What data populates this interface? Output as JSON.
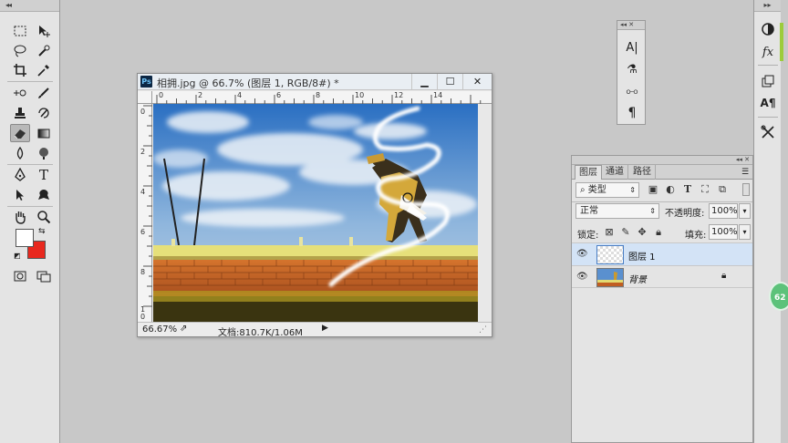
{
  "toolbox": {
    "grip": "◂◂",
    "tools": [
      {
        "name": "marquee-tool",
        "icon": "marquee-icon"
      },
      {
        "name": "move-tool",
        "icon": "move-icon"
      },
      {
        "name": "lasso-tool",
        "icon": "lasso-icon"
      },
      {
        "name": "quick-selection-tool",
        "icon": "quick-selection-icon"
      },
      {
        "name": "crop-tool",
        "icon": "crop-icon"
      },
      {
        "name": "eyedropper-tool",
        "icon": "eyedropper-icon"
      },
      {
        "name": "spot-healing-tool",
        "icon": "healing-icon"
      },
      {
        "name": "brush-tool",
        "icon": "brush-icon"
      },
      {
        "name": "clone-stamp-tool",
        "icon": "stamp-icon"
      },
      {
        "name": "history-brush-tool",
        "icon": "history-brush-icon"
      },
      {
        "name": "eraser-tool",
        "icon": "eraser-icon",
        "active": true
      },
      {
        "name": "gradient-tool",
        "icon": "gradient-icon"
      },
      {
        "name": "blur-tool",
        "icon": "blur-icon"
      },
      {
        "name": "dodge-tool",
        "icon": "dodge-icon"
      },
      {
        "name": "pen-tool",
        "icon": "pen-icon"
      },
      {
        "name": "type-tool",
        "icon": "type-icon",
        "glyph": "T"
      },
      {
        "name": "path-selection-tool",
        "icon": "path-selection-icon"
      },
      {
        "name": "shape-tool",
        "icon": "custom-shape-icon"
      },
      {
        "name": "hand-tool",
        "icon": "hand-icon"
      },
      {
        "name": "zoom-tool",
        "icon": "zoom-icon"
      }
    ],
    "foreground_color": "#ffffff",
    "background_color": "#e8281e"
  },
  "document": {
    "title": "相拥.jpg @ 66.7% (图层 1, RGB/8#) *",
    "app_badge": "Ps",
    "ruler_top": [
      "0",
      "2",
      "4",
      "6",
      "8",
      "10",
      "12",
      "14"
    ],
    "ruler_left": [
      "0",
      "2",
      "4",
      "6",
      "8",
      "1\n0"
    ],
    "status": {
      "zoom": "66.67%",
      "doc_size": "文档:810.7K/1.06M"
    }
  },
  "mini_panel": {
    "grip": "◂◂ ✕",
    "tools": [
      "character-icon",
      "paragraph-styles-icon",
      "brush-presets-icon",
      "paragraph-icon"
    ],
    "glyphs": [
      "A|",
      "⚗",
      "⧟",
      "¶"
    ]
  },
  "right_strip": {
    "grip": "▸▸",
    "tools": [
      "adjustments-icon",
      "styles-icon",
      "paths-icon",
      "character-styles-icon",
      "tool-presets-icon"
    ]
  },
  "layers_panel": {
    "grip": "◂◂ ✕",
    "tabs": [
      "图层",
      "通道",
      "路径"
    ],
    "filter": {
      "label": "ρ 类型",
      "value": "类型"
    },
    "blend_mode": "正常",
    "opacity_label": "不透明度:",
    "opacity_value": "100%",
    "lock_label": "锁定:",
    "fill_label": "填充:",
    "fill_value": "100%",
    "layers": [
      {
        "name": "图层 1",
        "selected": true,
        "locked": false
      },
      {
        "name": "背景",
        "selected": false,
        "locked": true,
        "italic": true
      }
    ]
  },
  "badge": "62"
}
